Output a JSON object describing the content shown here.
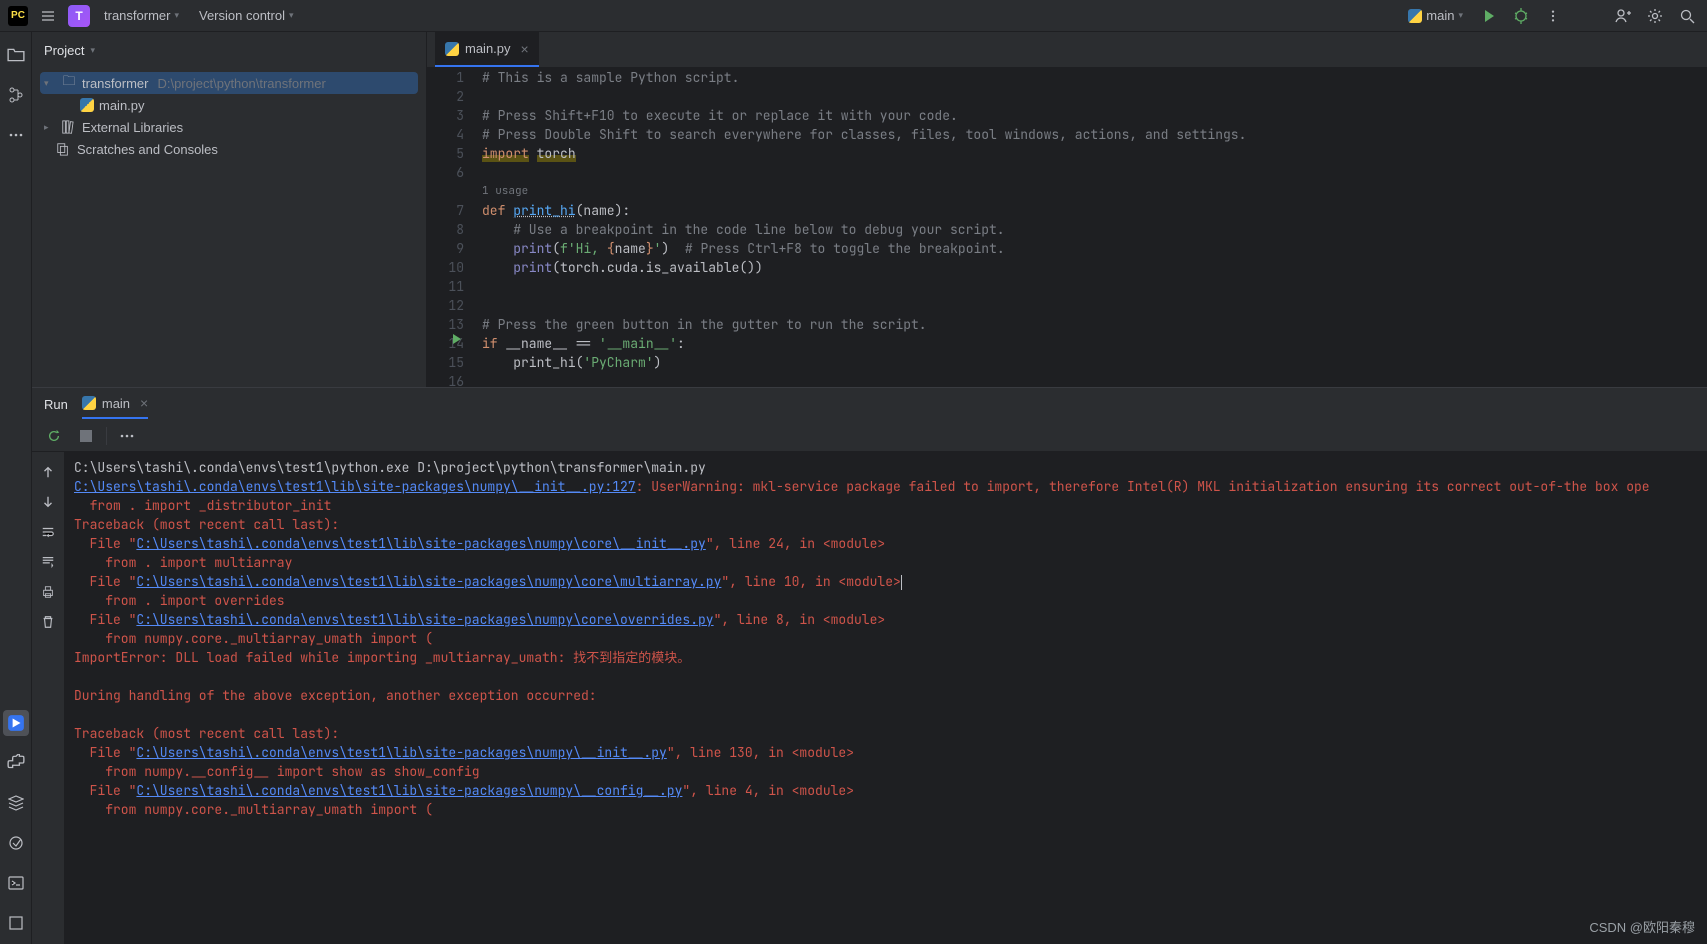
{
  "titlebar": {
    "project_name": "transformer",
    "version_control": "Version control",
    "run_config": "main",
    "proj_initial": "T"
  },
  "project_panel": {
    "title": "Project",
    "root_name": "transformer",
    "root_path": "D:\\project\\python\\transformer",
    "main_file": "main.py",
    "external_libs": "External Libraries",
    "scratches": "Scratches and Consoles"
  },
  "editor": {
    "tab_name": "main.py",
    "usage_label": "1 usage",
    "lines": [
      {
        "n": 1,
        "tokens": [
          [
            "c-comment",
            "# This is a sample Python script."
          ]
        ]
      },
      {
        "n": 2,
        "tokens": []
      },
      {
        "n": 3,
        "tokens": [
          [
            "c-comment",
            "# Press Shift+F10 to execute it or replace it with your code."
          ]
        ]
      },
      {
        "n": 4,
        "tokens": [
          [
            "c-comment",
            "# Press Double Shift to search everywhere for classes, files, tool windows, actions, and settings."
          ]
        ]
      },
      {
        "n": 5,
        "tokens": [
          [
            "c-keyword highlight-yellow",
            "import"
          ],
          [
            "",
            " "
          ],
          [
            "highlight-yellow",
            "torch"
          ]
        ]
      },
      {
        "n": 6,
        "tokens": []
      },
      {
        "usage": true
      },
      {
        "n": 7,
        "tokens": [
          [
            "c-def",
            "def "
          ],
          [
            "c-funcname c-underline",
            "print_hi"
          ],
          [
            "",
            "(name):"
          ]
        ]
      },
      {
        "n": 8,
        "tokens": [
          [
            "",
            "    "
          ],
          [
            "c-comment",
            "# Use a breakpoint in the code line below to debug your script."
          ]
        ]
      },
      {
        "n": 9,
        "tokens": [
          [
            "",
            "    "
          ],
          [
            "c-builtin",
            "print"
          ],
          [
            "",
            "("
          ],
          [
            "c-string",
            "f'Hi, "
          ],
          [
            "c-brace",
            "{"
          ],
          [
            "",
            "name"
          ],
          [
            "c-brace",
            "}"
          ],
          [
            "c-string",
            "'"
          ],
          [
            "",
            ")  "
          ],
          [
            "c-comment",
            "# Press Ctrl+F8 to toggle the breakpoint."
          ]
        ]
      },
      {
        "n": 10,
        "tokens": [
          [
            "",
            "    "
          ],
          [
            "c-builtin",
            "print"
          ],
          [
            "",
            "(torch.cuda.is_available())"
          ]
        ]
      },
      {
        "n": 11,
        "tokens": []
      },
      {
        "n": 12,
        "tokens": []
      },
      {
        "n": 13,
        "tokens": [
          [
            "c-comment",
            "# Press the green button in the gutter to run the script."
          ]
        ]
      },
      {
        "n": 14,
        "run": true,
        "tokens": [
          [
            "c-keyword",
            "if"
          ],
          [
            "",
            " __name__ == "
          ],
          [
            "c-string",
            "'__main__'"
          ],
          [
            "",
            ":"
          ]
        ]
      },
      {
        "n": 15,
        "tokens": [
          [
            "",
            "    print_hi("
          ],
          [
            "c-string",
            "'PyCharm'"
          ],
          [
            "",
            ")"
          ]
        ]
      },
      {
        "n": 16,
        "tokens": []
      }
    ]
  },
  "run": {
    "title": "Run",
    "tab_name": "main"
  },
  "console_lines": [
    [
      [
        "t-plain",
        "C:\\Users\\tashi\\.conda\\envs\\test1\\python.exe D:\\project\\python\\transformer\\main.py"
      ]
    ],
    [
      [
        "t-link",
        "C:\\Users\\tashi\\.conda\\envs\\test1\\lib\\site-packages\\numpy\\__init__.py:127"
      ],
      [
        "t-warn",
        ": UserWarning: mkl-service package failed to import, therefore Intel(R) MKL initialization ensuring its correct out-of-the box ope"
      ]
    ],
    [
      [
        "t-warn",
        "  from . import _distributor_init"
      ]
    ],
    [
      [
        "t-err",
        "Traceback (most recent call last):"
      ]
    ],
    [
      [
        "t-err",
        "  File \""
      ],
      [
        "t-link",
        "C:\\Users\\tashi\\.conda\\envs\\test1\\lib\\site-packages\\numpy\\core\\__init__.py"
      ],
      [
        "t-err",
        "\", line 24, in <module>"
      ]
    ],
    [
      [
        "t-err",
        "    from . import multiarray"
      ]
    ],
    [
      [
        "t-err",
        "  File \""
      ],
      [
        "t-link",
        "C:\\Users\\tashi\\.conda\\envs\\test1\\lib\\site-packages\\numpy\\core\\multiarray.py"
      ],
      [
        "t-err",
        "\", line 10, in <module>"
      ],
      [
        "cursor",
        ""
      ]
    ],
    [
      [
        "t-err",
        "    from . import overrides"
      ]
    ],
    [
      [
        "t-err",
        "  File \""
      ],
      [
        "t-link",
        "C:\\Users\\tashi\\.conda\\envs\\test1\\lib\\site-packages\\numpy\\core\\overrides.py"
      ],
      [
        "t-err",
        "\", line 8, in <module>"
      ]
    ],
    [
      [
        "t-err",
        "    from numpy.core._multiarray_umath import ("
      ]
    ],
    [
      [
        "t-err",
        "ImportError: DLL load failed while importing _multiarray_umath: 找不到指定的模块。"
      ]
    ],
    [
      [
        "",
        " "
      ]
    ],
    [
      [
        "t-err",
        "During handling of the above exception, another exception occurred:"
      ]
    ],
    [
      [
        "",
        " "
      ]
    ],
    [
      [
        "t-err",
        "Traceback (most recent call last):"
      ]
    ],
    [
      [
        "t-err",
        "  File \""
      ],
      [
        "t-link",
        "C:\\Users\\tashi\\.conda\\envs\\test1\\lib\\site-packages\\numpy\\__init__.py"
      ],
      [
        "t-err",
        "\", line 130, in <module>"
      ]
    ],
    [
      [
        "t-err",
        "    from numpy.__config__ import show as show_config"
      ]
    ],
    [
      [
        "t-err",
        "  File \""
      ],
      [
        "t-link",
        "C:\\Users\\tashi\\.conda\\envs\\test1\\lib\\site-packages\\numpy\\__config__.py"
      ],
      [
        "t-err",
        "\", line 4, in <module>"
      ]
    ],
    [
      [
        "t-err",
        "    from numpy.core._multiarray_umath import ("
      ]
    ]
  ],
  "watermark": "CSDN @欧阳秦穆"
}
